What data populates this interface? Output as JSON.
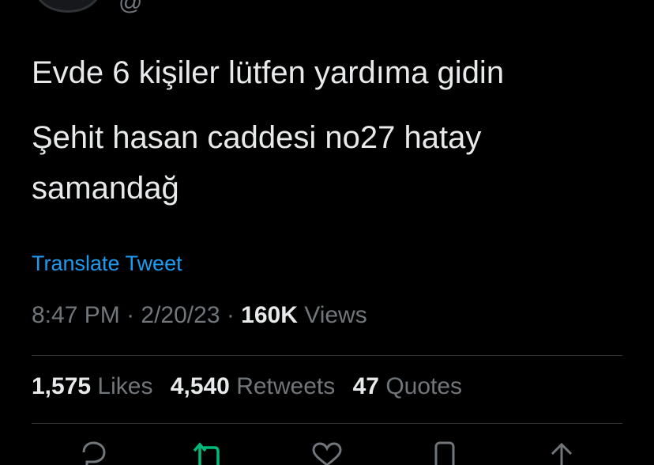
{
  "tweet": {
    "handle": "@",
    "text_line_1": "Evde 6 kişiler lütfen yardıma gidin",
    "text_line_2": "Şehit hasan caddesi no27 hatay",
    "text_line_3": "samandağ",
    "translate_label": "Translate Tweet",
    "time": "8:47 PM",
    "separator": " · ",
    "date": "2/20/23",
    "views_count": "160K",
    "views_label": " Views"
  },
  "stats": {
    "likes_count": "1,575",
    "likes_label": " Likes",
    "retweets_count": "4,540",
    "retweets_label": " Retweets",
    "quotes_count": "47",
    "quotes_label": " Quotes"
  },
  "colors": {
    "background": "#000000",
    "text": "#e7e9ea",
    "muted": "#71767b",
    "link": "#1d9bf0",
    "retweet_green": "#00ba7c",
    "divider": "#2f3336"
  },
  "icons": [
    "reply-icon",
    "retweet-icon",
    "like-icon",
    "bookmark-icon",
    "share-icon"
  ]
}
